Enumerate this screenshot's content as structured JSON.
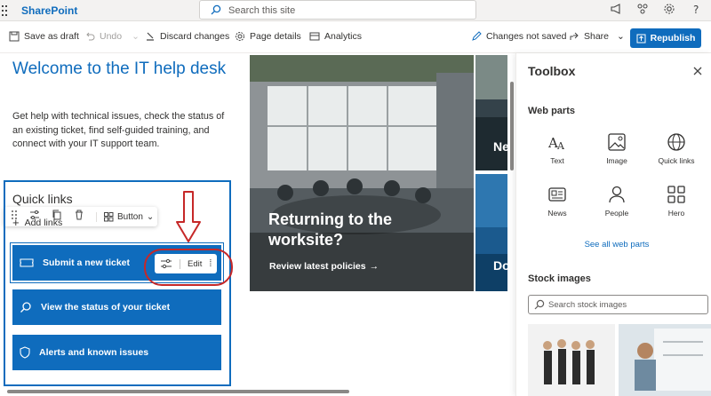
{
  "app": {
    "brand": "SharePoint",
    "search_placeholder": "Search this site"
  },
  "commandbar": {
    "save_draft": "Save as draft",
    "undo": "Undo",
    "discard": "Discard changes",
    "page_details": "Page details",
    "analytics": "Analytics",
    "status": "Changes not saved",
    "share": "Share",
    "republish": "Republish"
  },
  "page": {
    "title": "Welcome to the IT help desk",
    "description": "Get help with technical issues, check the status of an existing ticket, find self-guided training, and connect with your IT support team."
  },
  "webpart_toolbar": {
    "button_label": "Button"
  },
  "quick_links": {
    "title": "Quick links",
    "add_links": "Add links",
    "items": [
      {
        "label": "Submit a new ticket",
        "icon": "ticket-icon"
      },
      {
        "label": "View the status of your ticket",
        "icon": "search-icon"
      },
      {
        "label": "Alerts and known issues",
        "icon": "shield-icon"
      }
    ],
    "edit_label": "Edit"
  },
  "hero": {
    "title_line1": "Returning to the",
    "title_line2": "worksite?",
    "link": "Review latest policies",
    "side1_text": "Ne",
    "side2_text": "Do"
  },
  "toolbox": {
    "title": "Toolbox",
    "webparts_heading": "Web parts",
    "webparts": [
      {
        "label": "Text",
        "icon": "text-icon"
      },
      {
        "label": "Image",
        "icon": "image-icon"
      },
      {
        "label": "Quick links",
        "icon": "globe-icon"
      },
      {
        "label": "News",
        "icon": "news-icon"
      },
      {
        "label": "People",
        "icon": "person-icon"
      },
      {
        "label": "Hero",
        "icon": "hero-icon"
      }
    ],
    "see_all": "See all web parts",
    "stock_heading": "Stock images",
    "stock_search_placeholder": "Search stock images"
  },
  "colors": {
    "accent": "#0f6cbd",
    "annotation": "#c62828"
  }
}
